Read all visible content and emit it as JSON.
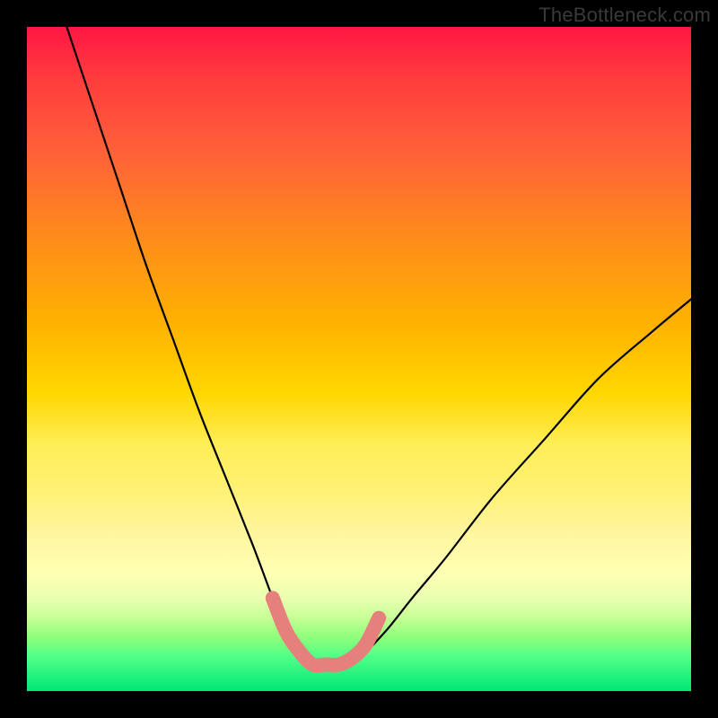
{
  "watermark": "TheBottleneck.com",
  "chart_data": {
    "type": "line",
    "title": "",
    "xlabel": "",
    "ylabel": "",
    "xlim": [
      0,
      100
    ],
    "ylim": [
      0,
      100
    ],
    "note": "Bottleneck-style gradient plot. X: normalized component ratio. Y: bottleneck % (0=green/na dně, 100=red). Curve 'main' je hlavní V-tvar; 'marker' je růžový zvýrazněný segment poblíž minima.",
    "series": [
      {
        "name": "main",
        "x": [
          6,
          10,
          14,
          18,
          22,
          26,
          30,
          34,
          37,
          39,
          41,
          43,
          45,
          47,
          50,
          54,
          58,
          63,
          70,
          78,
          86,
          94,
          100
        ],
        "values": [
          100,
          88,
          76,
          64,
          53,
          42,
          32,
          22,
          14,
          9,
          6,
          4,
          4,
          4,
          5,
          9,
          14,
          20,
          29,
          38,
          47,
          54,
          59
        ]
      },
      {
        "name": "marker",
        "x": [
          37,
          39,
          41,
          43,
          45,
          47,
          49,
          51,
          53
        ],
        "values": [
          14,
          9,
          6,
          4,
          4,
          4,
          5,
          7,
          11
        ]
      }
    ],
    "colors": {
      "main_stroke": "#000000",
      "marker_stroke": "#e6807c",
      "gradient_top": "#ff1744",
      "gradient_bottom": "#00e676"
    }
  }
}
